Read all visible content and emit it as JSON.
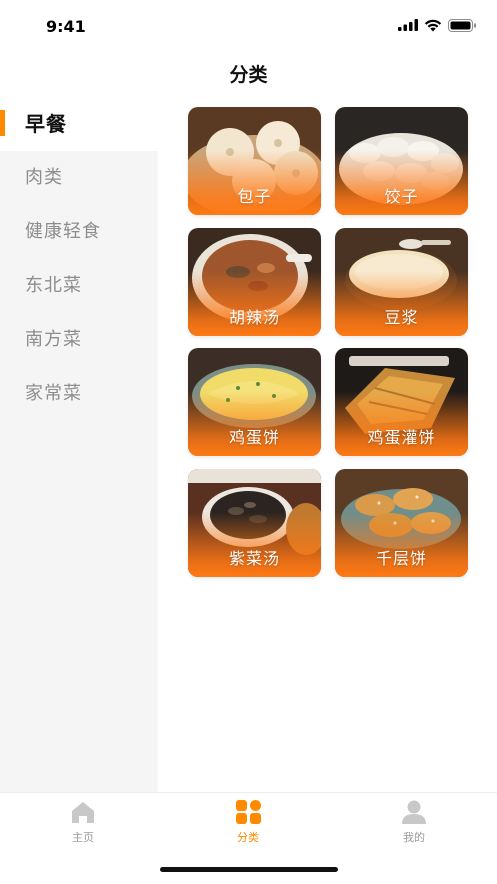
{
  "status_bar": {
    "time": "9:41",
    "icons": [
      "cellular-signal-icon",
      "wifi-icon",
      "battery-icon"
    ]
  },
  "page": {
    "title": "分类"
  },
  "sidebar": {
    "active_index": 0,
    "items": [
      {
        "label": "早餐"
      },
      {
        "label": "肉类"
      },
      {
        "label": "健康轻食"
      },
      {
        "label": "东北菜"
      },
      {
        "label": "南方菜"
      },
      {
        "label": "家常菜"
      }
    ]
  },
  "grid": {
    "items": [
      {
        "label": "包子"
      },
      {
        "label": "饺子"
      },
      {
        "label": "胡辣汤"
      },
      {
        "label": "豆浆"
      },
      {
        "label": "鸡蛋饼"
      },
      {
        "label": "鸡蛋灌饼"
      },
      {
        "label": "紫菜汤"
      },
      {
        "label": "千层饼"
      }
    ]
  },
  "tab_bar": {
    "active_index": 1,
    "accent_color": "#ff8a00",
    "tabs": [
      {
        "label": "主页",
        "icon": "home-icon"
      },
      {
        "label": "分类",
        "icon": "category-icon"
      },
      {
        "label": "我的",
        "icon": "user-icon"
      }
    ]
  }
}
